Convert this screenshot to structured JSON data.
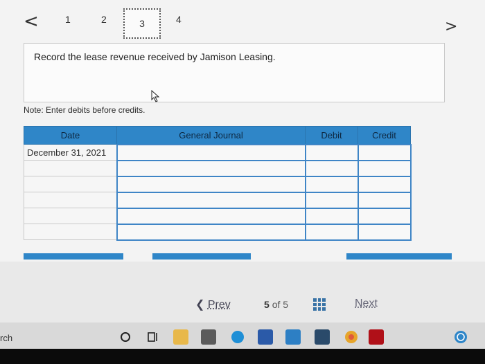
{
  "nav": {
    "prev_arrow": "<",
    "next_arrow": ">",
    "pages": [
      "1",
      "2",
      "3",
      "4"
    ],
    "active_page": "3"
  },
  "instruction": "Record the lease revenue received by Jamison Leasing.",
  "note": "Note: Enter debits before credits.",
  "journal": {
    "headers": [
      "Date",
      "General Journal",
      "Debit",
      "Credit"
    ],
    "rows": [
      [
        "December 31, 2021",
        "",
        "",
        ""
      ],
      [
        "",
        "",
        "",
        ""
      ],
      [
        "",
        "",
        "",
        ""
      ],
      [
        "",
        "",
        "",
        ""
      ],
      [
        "",
        "",
        "",
        ""
      ],
      [
        "",
        "",
        "",
        ""
      ]
    ]
  },
  "pager": {
    "prev_label": "Prev",
    "current": "5",
    "of": "of",
    "total": "5",
    "next_label": "Next"
  },
  "taskbar": {
    "search_stub": "rch",
    "icons": [
      "cortana-circle-icon",
      "task-view-icon",
      "file-explorer-icon",
      "store-icon",
      "edge-icon",
      "word-icon",
      "mail-icon",
      "app-icon",
      "chrome-icon",
      "netflix-icon",
      "help-icon"
    ]
  },
  "colors": {
    "accent": "#2f86c8",
    "header_text": "#0d2740"
  }
}
